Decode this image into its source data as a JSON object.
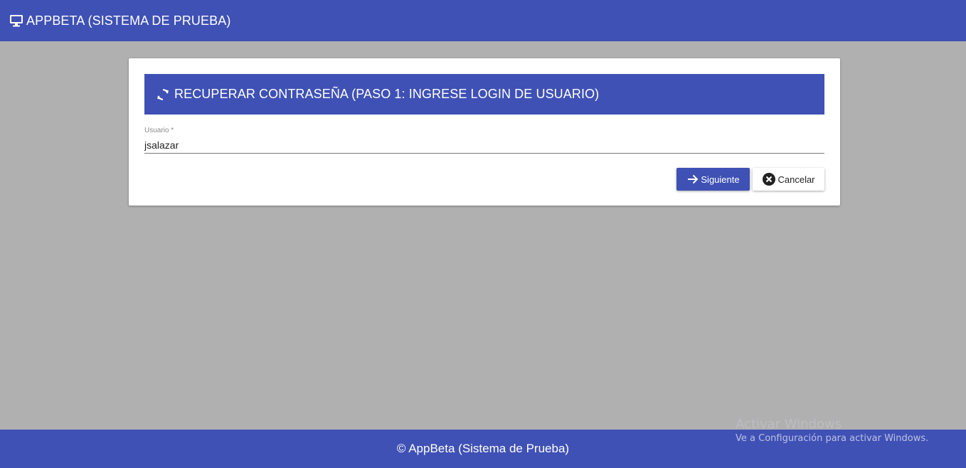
{
  "topbar": {
    "title": "APPBETA (SISTEMA DE PRUEBA)",
    "icon": "desktop-icon"
  },
  "card": {
    "title": "RECUPERAR CONTRASEÑA (PASO 1: INGRESE LOGIN DE USUARIO)",
    "icon": "refresh-icon",
    "field": {
      "label": "Usuario *",
      "value": "jsalazar"
    },
    "buttons": {
      "next_label": "Siguiente",
      "cancel_label": "Cancelar"
    }
  },
  "footer": {
    "text": "© AppBeta (Sistema de Prueba)"
  },
  "watermark": {
    "title": "Activar Windows",
    "subtitle": "Ve a Configuración para activar Windows."
  },
  "colors": {
    "primary": "#3f51b5",
    "background": "#b0b0b0"
  }
}
